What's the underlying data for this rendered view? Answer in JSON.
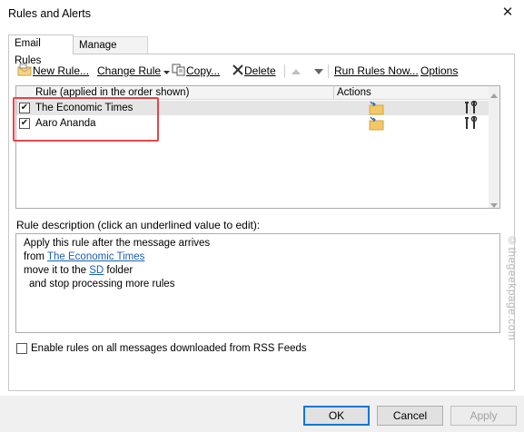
{
  "window": {
    "title": "Rules and Alerts",
    "close_glyph": "✕"
  },
  "tabs": [
    {
      "label": "Email Rules",
      "active": true
    },
    {
      "label": "Manage Alerts",
      "active": false
    }
  ],
  "toolbar": {
    "new_rule": "New Rule...",
    "change_rule": "Change Rule",
    "copy": "Copy...",
    "delete": "Delete",
    "run_rules_now": "Run Rules Now...",
    "options": "Options"
  },
  "rules_table": {
    "col_rule": "Rule (applied in the order shown)",
    "col_actions": "Actions",
    "rows": [
      {
        "name": "The Economic Times",
        "checked": true,
        "selected": true
      },
      {
        "name": "Aaro Ananda",
        "checked": true,
        "selected": false
      }
    ]
  },
  "description": {
    "label": "Rule description (click an underlined value to edit):",
    "line1": "Apply this rule after the message arrives",
    "line2_prefix": "from ",
    "line2_link": "The Economic Times",
    "line3_prefix": "move it to the ",
    "line3_link": "SD",
    "line3_suffix": " folder",
    "line4": "and stop processing more rules"
  },
  "rss": {
    "label": "Enable rules on all messages downloaded from RSS Feeds",
    "checked": false
  },
  "buttons": {
    "ok": "OK",
    "cancel": "Cancel",
    "apply": "Apply"
  },
  "watermark": "©thegeekpage.com",
  "colors": {
    "highlight_border": "#e0474c",
    "link": "#1a5fb4",
    "primary_border": "#0078d7"
  }
}
